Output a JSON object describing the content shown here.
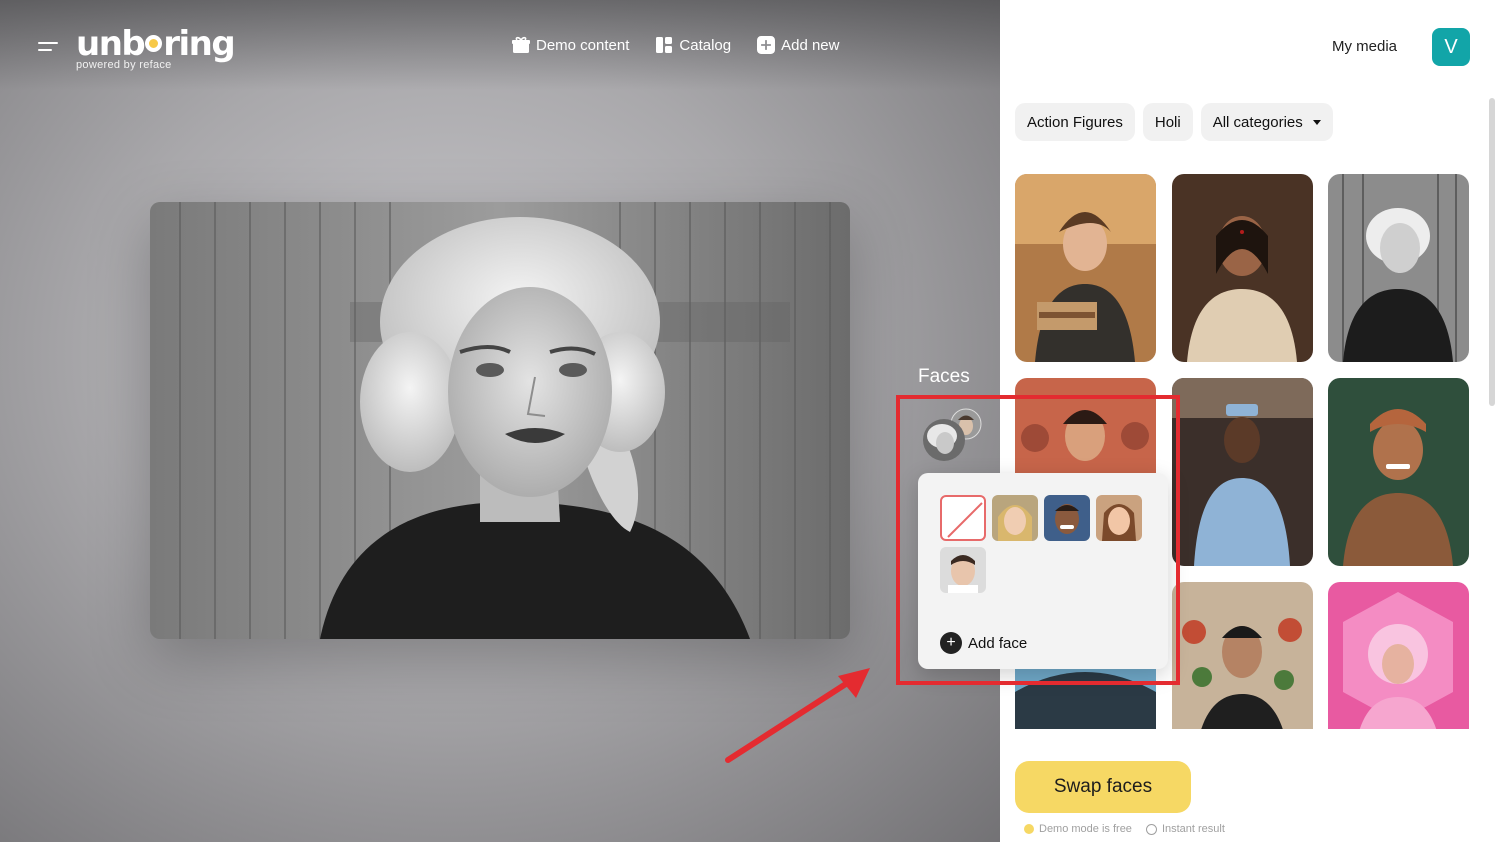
{
  "app": {
    "logo_main": "unboring",
    "logo_sub": "powered by reface"
  },
  "nav": [
    {
      "label": "Demo content",
      "icon": "gift-icon"
    },
    {
      "label": "Catalog",
      "icon": "catalog-icon"
    },
    {
      "label": "Add new",
      "icon": "plus-square-icon"
    }
  ],
  "faces_panel": {
    "title": "Faces",
    "add_face_label": "Add face"
  },
  "header": {
    "my_media": "My media",
    "avatar_letter": "V",
    "avatar_color": "#12a5a8"
  },
  "categories": {
    "chips": [
      "Action Figures",
      "Holi"
    ],
    "dropdown": "All categories"
  },
  "gallery": [
    "student-books-thumbnail",
    "indian-woman-thumbnail",
    "marilyn-bw-thumbnail",
    "holi-crowd-thumbnail",
    "flight-attendant-thumbnail",
    "smiling-man-turban-thumbnail",
    "ocean-scene-thumbnail",
    "floral-portrait-thumbnail",
    "pink-astronaut-thumbnail"
  ],
  "actions": {
    "swap_label": "Swap faces",
    "demo_note": "Demo mode is free",
    "instant_note": "Instant result"
  },
  "colors": {
    "accent_yellow": "#f6d864",
    "highlight_red": "#e42b30"
  }
}
